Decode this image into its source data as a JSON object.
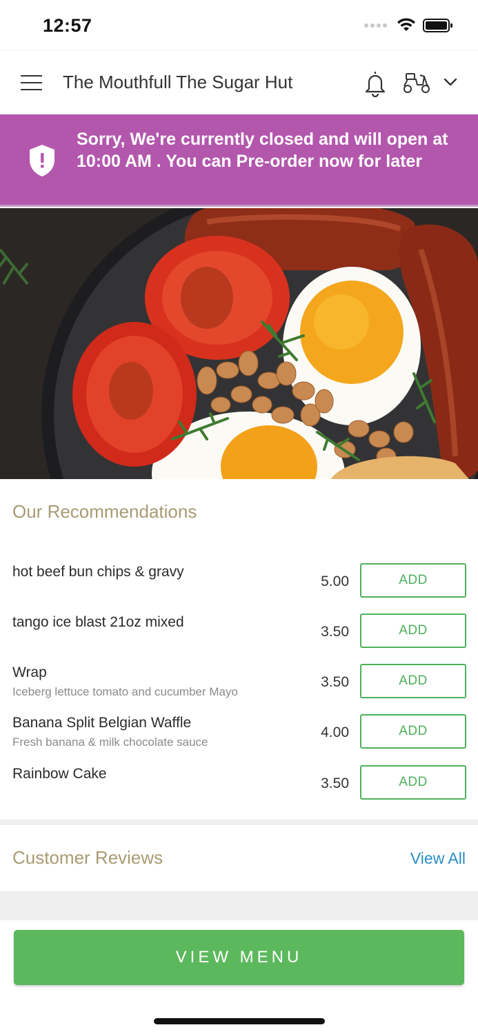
{
  "status_bar": {
    "time": "12:57"
  },
  "header": {
    "title": "The Mouthfull The Sugar Hut"
  },
  "banner": {
    "message": "Sorry, We're currently closed and will open at 10:00 AM . You can Pre-order now for later",
    "background_color": "#b357ad"
  },
  "recommendations": {
    "title": "Our Recommendations",
    "items": [
      {
        "name": "hot beef bun chips & gravy",
        "description": "",
        "price": "5.00",
        "button": "ADD"
      },
      {
        "name": "tango ice blast 21oz mixed",
        "description": "",
        "price": "3.50",
        "button": "ADD"
      },
      {
        "name": "Wrap",
        "description": "Iceberg lettuce tomato and cucumber Mayo",
        "price": "3.50",
        "button": "ADD"
      },
      {
        "name": "Banana Split Belgian Waffle",
        "description": "Fresh banana & milk chocolate sauce",
        "price": "4.00",
        "button": "ADD"
      },
      {
        "name": "Rainbow Cake",
        "description": "",
        "price": "3.50",
        "button": "ADD"
      }
    ]
  },
  "reviews": {
    "title": "Customer Reviews",
    "view_all": "View All"
  },
  "footer": {
    "button_label": "VIEW MENU",
    "accent_color": "#5cb85c"
  },
  "icons": [
    "hamburger-menu-icon",
    "bell-icon",
    "delivery-scooter-icon",
    "chevron-down-icon",
    "shield-alert-icon",
    "wifi-icon",
    "battery-icon"
  ]
}
